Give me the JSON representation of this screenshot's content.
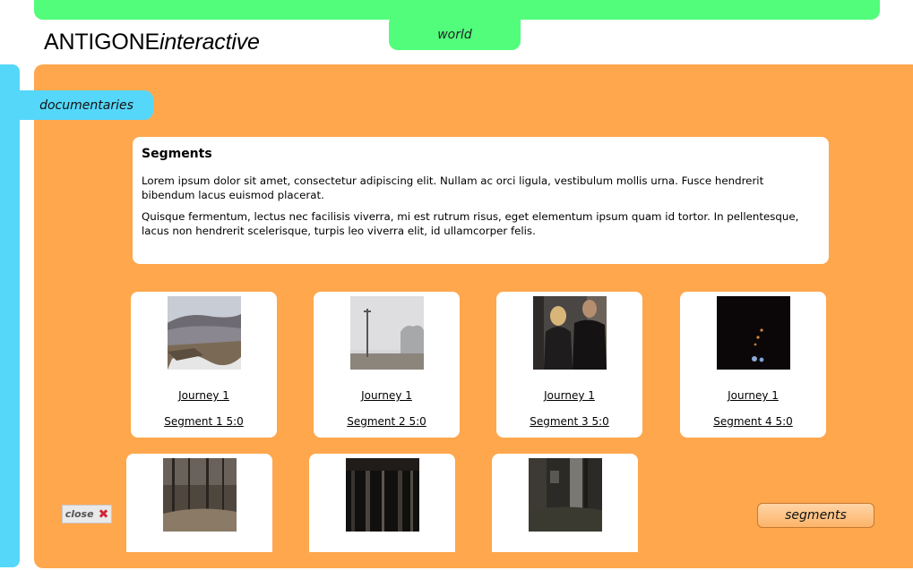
{
  "header": {
    "logo_prefix": "ANTIGONE",
    "logo_suffix": "interactive",
    "world_tab": "world"
  },
  "sidebar": {
    "documentaries_tab": "documentaries"
  },
  "info": {
    "title": "Segments",
    "paragraphs": [
      "Lorem ipsum dolor sit amet, consectetur adipiscing elit. Nullam ac orci ligula, vestibulum mollis urna. Fusce hendrerit bibendum lacus euismod placerat.",
      "Quisque fermentum, lectus nec facilisis viverra, mi est rutrum risus, eget elementum ipsum quam id tortor. In pellentesque, lacus non hendrerit scelerisque, turpis leo viverra elit, id ullamcorper felis."
    ]
  },
  "segments": [
    {
      "journey": "Journey 1",
      "segment": "Segment 1 5:0",
      "thumb": "snowy-moor"
    },
    {
      "journey": "Journey 1",
      "segment": "Segment 2 5:0",
      "thumb": "foggy-pole"
    },
    {
      "journey": "Journey 1",
      "segment": "Segment 3 5:0",
      "thumb": "people-street"
    },
    {
      "journey": "Journey 1",
      "segment": "Segment 4 5:0",
      "thumb": "dark-tunnel"
    },
    {
      "thumb": "bare-forest"
    },
    {
      "thumb": "dark-pine-forest"
    },
    {
      "thumb": "shadowy-woods"
    }
  ],
  "footer": {
    "close_label": "close",
    "segments_button": "segments"
  },
  "colors": {
    "green": "#52fd7c",
    "blue": "#55d7f9",
    "orange": "#fea74d"
  }
}
